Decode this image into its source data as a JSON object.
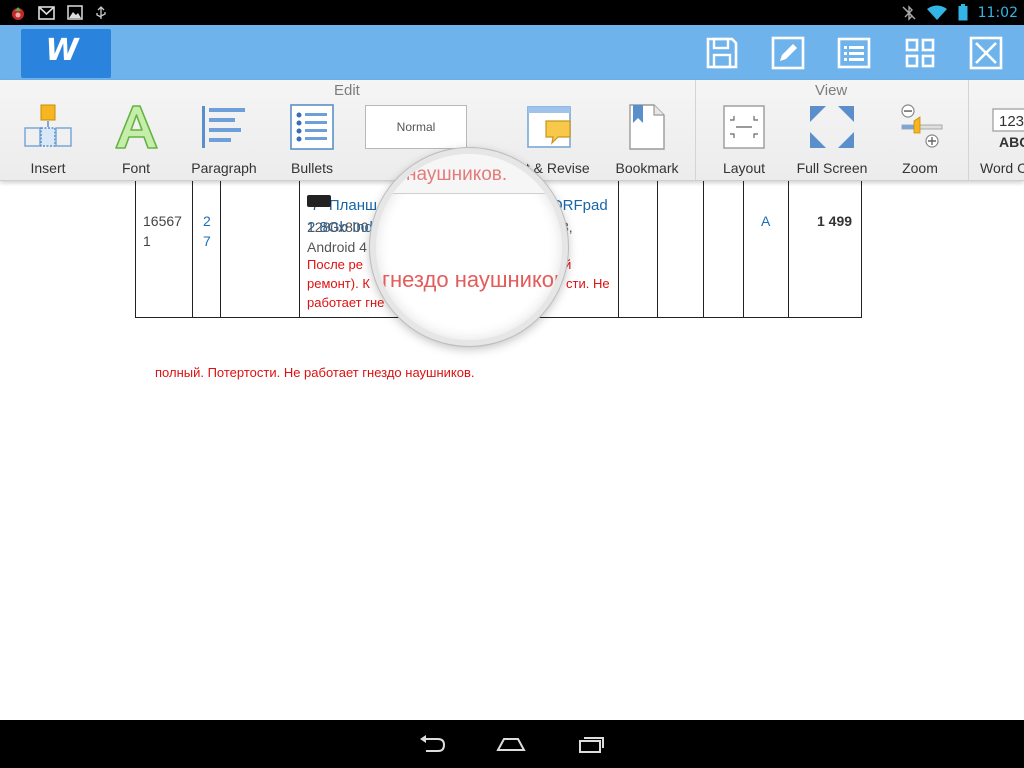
{
  "status_bar": {
    "time": "11:02",
    "left_icons": [
      "app-notification-icon",
      "gmail-icon",
      "gallery-icon",
      "usb-debug-icon"
    ],
    "right_icons": [
      "bluetooth-off-icon",
      "wifi-icon",
      "battery-icon"
    ]
  },
  "app_bar": {
    "logo_letter": "W",
    "actions": [
      "save-icon",
      "edit-icon",
      "list-icon",
      "grid-icon",
      "close-icon"
    ]
  },
  "ribbon": {
    "groups": [
      {
        "label": "Edit"
      },
      {
        "label": "View"
      }
    ],
    "items": [
      {
        "label": "Insert"
      },
      {
        "label": "Font"
      },
      {
        "label": "Paragraph"
      },
      {
        "label": "Bullets"
      },
      {
        "label": "S",
        "style_value": "Normal"
      },
      {
        "label": "ent & Revise"
      },
      {
        "label": "Bookmark"
      },
      {
        "label": "Layout"
      },
      {
        "label": "Full Screen"
      },
      {
        "label": "Zoom"
      },
      {
        "label": "Word C",
        "icon_text_top": "123",
        "icon_text_bottom": "ABC"
      }
    ]
  },
  "document": {
    "row": {
      "id": [
        "16567",
        "1"
      ],
      "qty": [
        "2",
        "7"
      ],
      "title": [
        "7\" Планш",
        "2 8Gb Ind"
      ],
      "title_suffix": "ORFpad",
      "specs": [
        "1280x800",
        "Android 4"
      ],
      "specs_suffix": "3,",
      "note": [
        "После ре",
        "ремонт). К",
        "работает гне"
      ],
      "note_suffix_1": "й",
      "note_suffix_2": "сти. Не",
      "grade": "A",
      "price": "1 499"
    },
    "footnote": "полный. Потертости. Не работает гнездо наушников."
  },
  "magnifier": {
    "top_text": "наушников.",
    "main_text": "гнездо наушников."
  },
  "nav_bar": {
    "buttons": [
      "back-icon",
      "home-icon",
      "recent-apps-icon"
    ]
  },
  "colors": {
    "app_bar": "#6fb3ec",
    "logo_bg": "#2a83dd",
    "link_blue": "#1a66a8",
    "note_red": "#dd1111",
    "clock_blue": "#33b5e5"
  }
}
